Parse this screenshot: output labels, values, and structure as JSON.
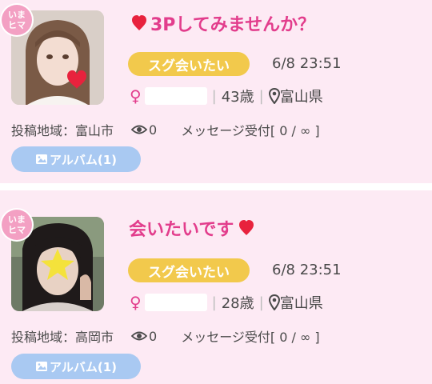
{
  "posts": [
    {
      "badge": "いまヒマ",
      "title": "3Pしてみませんか？",
      "tag": "スグ会いたい",
      "datetime": "6/8 23:51",
      "gender_symbol": "♀",
      "age": "43歳",
      "prefecture": "富山県",
      "area_label": "投稿地域：富山市",
      "views": "0",
      "message_label": "メッセージ受付[ 0 / ∞ ]",
      "album": "アルバム(1)"
    },
    {
      "badge": "いまヒマ",
      "title": "会いたいです",
      "tag": "スグ会いたい",
      "datetime": "6/8 23:51",
      "gender_symbol": "♀",
      "age": "28歳",
      "prefecture": "富山県",
      "area_label": "投稿地域：高岡市",
      "views": "0",
      "message_label": "メッセージ受付[ 0 / ∞ ]",
      "album": "アルバム(1)"
    }
  ],
  "colors": {
    "card_bg": "#fdeaf4",
    "title": "#e23d8c",
    "tag": "#f2c94c",
    "album": "#a9c9f2",
    "badge": "#f3a0c3"
  }
}
